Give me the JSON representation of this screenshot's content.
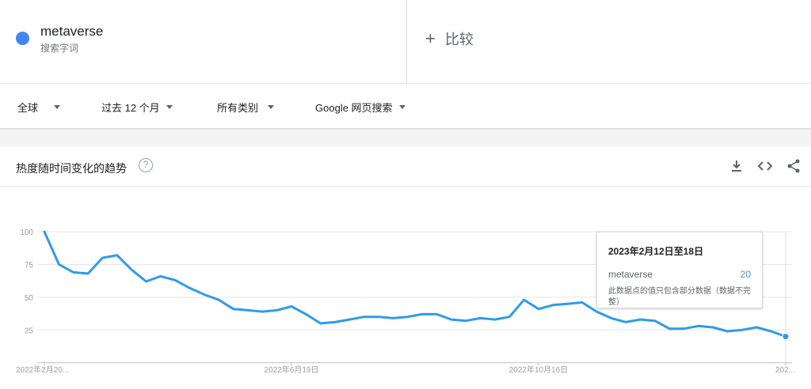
{
  "term": {
    "name": "metaverse",
    "type": "搜索字词",
    "color": "#4285f4"
  },
  "compare": {
    "label": "比较"
  },
  "filters": [
    {
      "label": "全球"
    },
    {
      "label": "过去 12 个月"
    },
    {
      "label": "所有类别"
    },
    {
      "label": "Google 网页搜索"
    }
  ],
  "panel": {
    "title": "热度随时间变化的趋势",
    "help": "?"
  },
  "tooltip": {
    "date": "2023年2月12日至18日",
    "term": "metaverse",
    "value": "20",
    "note": "此数据点的值只包含部分数据（数据不完整）"
  },
  "chart_data": {
    "type": "line",
    "color": "#2f9be9",
    "yticks": [
      100,
      75,
      50,
      25
    ],
    "ylim": [
      0,
      100
    ],
    "xtick_labels": [
      "2022年2月20...",
      "2022年6月19日",
      "2022年10月16日",
      "202..."
    ],
    "xtick_index": [
      0,
      17,
      34,
      51
    ],
    "series": [
      {
        "name": "metaverse",
        "values": [
          100,
          75,
          69,
          68,
          80,
          82,
          71,
          62,
          66,
          63,
          57,
          52,
          48,
          41,
          40,
          39,
          40,
          43,
          37,
          30,
          31,
          33,
          35,
          35,
          34,
          35,
          37,
          37,
          33,
          32,
          34,
          33,
          35,
          48,
          41,
          44,
          45,
          46,
          39,
          34,
          31,
          33,
          32,
          26,
          26,
          28,
          27,
          24,
          25,
          27,
          24,
          20
        ]
      }
    ]
  }
}
